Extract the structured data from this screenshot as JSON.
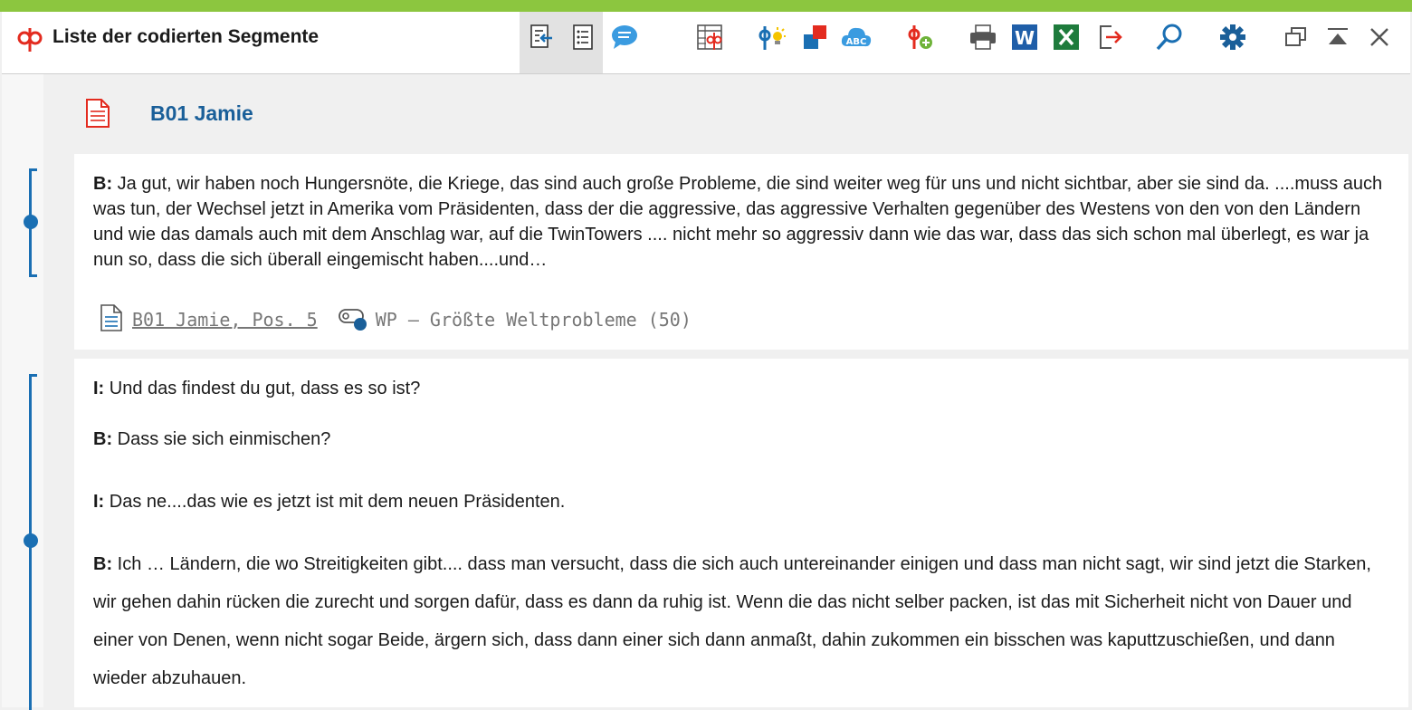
{
  "window": {
    "title": "Liste der codierten Segmente"
  },
  "toolbar": {
    "items": [
      "import-into-document-icon",
      "list-view-icon",
      "comment-icon",
      "table-overview-icon",
      "code-memo-icon",
      "color-code-icon",
      "word-cloud-icon",
      "add-code-icon",
      "print-icon",
      "word-export-icon",
      "excel-export-icon",
      "export-icon",
      "search-icon",
      "settings-icon",
      "undock-window-icon",
      "maximize-icon",
      "close-icon"
    ],
    "word_label": "W"
  },
  "document": {
    "title": "B01 Jamie"
  },
  "segments": [
    {
      "speaker": "B:",
      "text": " Ja gut, wir haben noch Hungersnöte, die Kriege, das sind auch große Probleme, die sind weiter weg für uns und nicht sichtbar, aber sie sind da. ....muss auch was tun, der Wechsel jetzt in Amerika vom Präsidenten, dass der die aggressive, das aggressive Verhalten gegenüber des Westens von den von den Ländern und wie das damals auch mit dem Anschlag war, auf die TwinTowers .... nicht mehr so aggressiv dann wie das war, dass das sich schon mal überlegt, es war ja nun so, dass die sich überall eingemischt haben....und…",
      "source": "B01 Jamie, Pos. 5",
      "code": "WP – Größte Weltprobleme (50)"
    }
  ],
  "segment2": {
    "lines": [
      {
        "speaker": "I:",
        "text": " Und das findest du gut, dass es so ist?"
      },
      {
        "speaker": "B:",
        "text": " Dass sie sich einmischen?"
      },
      {
        "speaker": "I:",
        "text": " Das ne....das wie es jetzt ist mit dem neuen Präsidenten."
      }
    ],
    "long_speaker": "B:",
    "long_text": " Ich … Ländern, die wo Streitigkeiten gibt.... dass man versucht, dass die sich auch untereinander einigen und dass man nicht sagt, wir sind jetzt die Starken, wir gehen dahin rücken die zurecht und sorgen dafür, dass es dann da ruhig ist. Wenn die das nicht selber packen, ist das mit Sicherheit nicht von Dauer und einer von Denen, wenn nicht sogar Beide, ärgern sich, dass dann einer sich dann anmaßt, dahin zukommen ein bisschen was kaputtzuschießen, und dann wieder abzuhauen."
  },
  "colors": {
    "accent_bar": "#8cc63f",
    "link_blue": "#1a6fb3",
    "title_blue": "#1a5f99"
  }
}
